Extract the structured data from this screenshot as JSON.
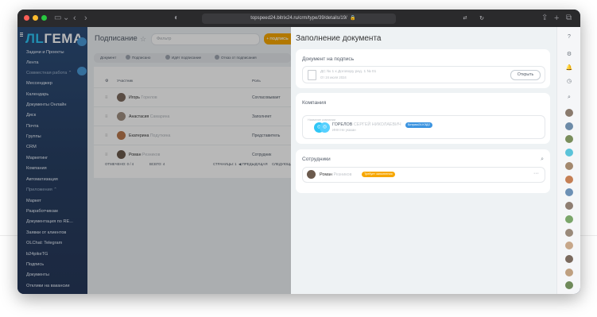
{
  "browser": {
    "url": "topspeed24.bitrix24.ru/crm/type/39/details/19/"
  },
  "sidebar": {
    "logo_main": "ЛL",
    "logo_rest": "ГЕМА",
    "items": [
      {
        "label": "Задачи и Проекты"
      },
      {
        "label": "Лента"
      },
      {
        "label": "Совместная работа ⌃",
        "group": true
      },
      {
        "label": "Мессенджер"
      },
      {
        "label": "Календарь"
      },
      {
        "label": "Документы Онлайн"
      },
      {
        "label": "Диск"
      },
      {
        "label": "Почта"
      },
      {
        "label": "Группы"
      },
      {
        "label": "CRM"
      },
      {
        "label": "Маркетинг"
      },
      {
        "label": "Компания"
      },
      {
        "label": "Автоматизация"
      },
      {
        "label": "Приложения ⌃",
        "group": true
      },
      {
        "label": "Маркет"
      },
      {
        "label": "Разработчикам"
      },
      {
        "label": "Документация по RE..."
      },
      {
        "label": "Заявки от клиентов"
      },
      {
        "label": "OLChat: Telegram"
      },
      {
        "label": "b24pikeTG"
      },
      {
        "label": "Подпись"
      },
      {
        "label": "Документы"
      },
      {
        "label": "Отклики на вакансии"
      }
    ]
  },
  "main": {
    "title": "Подписание",
    "filter_placeholder": "Фильтр",
    "add_button": "+ ПОДПИСЬ",
    "tabs": [
      {
        "label": "Документ"
      },
      {
        "label": "Подписано"
      },
      {
        "label": "Идёт подписание"
      },
      {
        "label": "Отказ от подписания"
      }
    ],
    "columns": {
      "participant": "Участник",
      "role": "Роль"
    },
    "rows": [
      {
        "first": "Игорь",
        "last": "Гoрeлов",
        "role": "Согласовывает"
      },
      {
        "first": "Анастасия",
        "last": "Сaмaрина",
        "role": "Заполняет"
      },
      {
        "first": "Екатерина",
        "last": "Пoдуткина",
        "role": "Представитель"
      },
      {
        "first": "Роман",
        "last": "Рeзников",
        "role": "Сотрудник"
      }
    ],
    "footer": {
      "selected": "ОТМЕЧЕНО: 0 / 4",
      "total": "ВСЕГО: 4",
      "pages": "СТРАНИЦЫ: 1",
      "prev": "◀ ПРЕДЫДУЩАЯ",
      "next": "СЛЕДУЮЩАЯ"
    }
  },
  "panel": {
    "title": "Заполнение документа",
    "doc_card": {
      "header": "Документ на подпись",
      "doc_name": "ДС № 1 к Договору ред. 1 № 01",
      "doc_date": "От 24 июля 2024",
      "open_button": "Открыть"
    },
    "company_card": {
      "header": "Компания",
      "field_label": "Название компании",
      "name": "ГОРЕЛОВ",
      "name_rest": "СЕРГЕЙ НИКОЛАЕВИЧ",
      "badge": "Битрикс24.КЭДО",
      "inn": "ИНН",
      "inn_value": "Не указан"
    },
    "employees_card": {
      "header": "Сотрудники",
      "employee_first": "Роман",
      "employee_last": "Резников",
      "status": "Требует заполнения"
    }
  },
  "colors": {
    "accent": "#2fc6f6",
    "warning": "#f7a700",
    "sidebar_bg": "#2d4e7a",
    "panel_bg": "#eef2f4"
  },
  "icons": [
    "search-icon",
    "bell-icon",
    "help-icon",
    "star-icon",
    "lock-icon",
    "refresh-icon",
    "share-icon",
    "plus-icon",
    "tabs-icon"
  ]
}
